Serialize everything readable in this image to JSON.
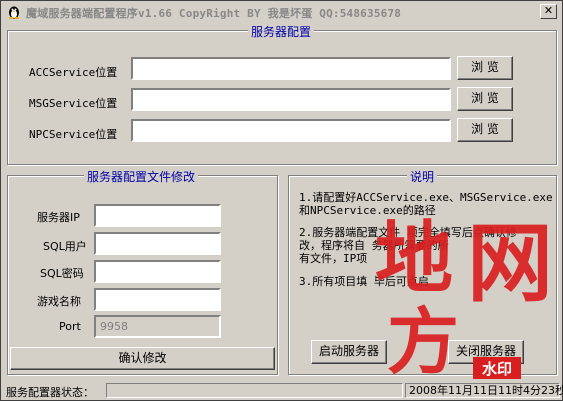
{
  "window": {
    "title": "魔域服务器端配置程序v1.66  CopyRight BY 我是坏蛋 QQ:548635678",
    "close_glyph": "✕"
  },
  "server_config": {
    "group_title": "服务器配置",
    "rows": [
      {
        "label": "ACCService位置",
        "value": "",
        "button": "浏 览"
      },
      {
        "label": "MSGService位置",
        "value": "",
        "button": "浏 览"
      },
      {
        "label": "NPCService位置",
        "value": "",
        "button": "浏 览"
      }
    ]
  },
  "file_config": {
    "group_title": "服务器配置文件修改",
    "fields": [
      {
        "label": "服务器IP",
        "value": ""
      },
      {
        "label": "SQL用户",
        "value": ""
      },
      {
        "label": "SQL密码",
        "value": ""
      },
      {
        "label": "游戏名称",
        "value": ""
      },
      {
        "label": "Port",
        "value": "9958"
      }
    ],
    "confirm_button": "确认修改"
  },
  "instructions": {
    "group_title": "说明",
    "lines": [
      "1.请配置好ACCService.exe、MSGService.exe",
      "   和NPCService.exe的路径",
      "",
      "2.服务器端配置文件  项完全填写后点确认修",
      "改，程序将自       务器所需要的所",
      "有文件，IP项",
      "",
      "3.所有项目填    毕后可点启"
    ],
    "start_button": "启动服务器",
    "stop_button": "关闭服务器"
  },
  "status_bar": {
    "label": "服务配置器状态：",
    "message": "",
    "datetime": "2008年11月11日11时4分23秒"
  },
  "watermark": {
    "chars": [
      "地",
      "网",
      "方"
    ],
    "badge": "水印",
    "color": "#d81e1e"
  }
}
